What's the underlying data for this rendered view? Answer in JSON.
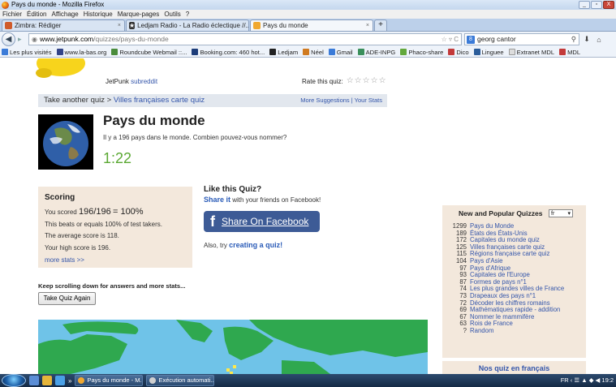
{
  "window": {
    "title": "Pays du monde - Mozilla Firefox",
    "controls": [
      "_",
      "▫",
      "X"
    ]
  },
  "menu": [
    "Fichier",
    "Édition",
    "Affichage",
    "Historique",
    "Marque-pages",
    "Outils",
    "?"
  ],
  "tabs": [
    {
      "label": "Zimbra: Rédiger",
      "icon_color": "#d05b2a"
    },
    {
      "label": "Ledjam Radio - La Radio éclectique //...",
      "icon_color": "#333333"
    },
    {
      "label": "Pays du monde",
      "icon_color": "#f0a830",
      "active": true
    }
  ],
  "newtab": "+",
  "urlbar": {
    "host": "www.jetpunk.com",
    "path": "/quizzes/pays-du-monde",
    "icons": "☆ ▿ C"
  },
  "search": {
    "value": "georg cantor",
    "engine_letter": "8"
  },
  "bookmarks": [
    {
      "label": "Les plus visités",
      "color": "#3b7bd8"
    },
    {
      "label": "www.la-bas.org",
      "color": "#334488"
    },
    {
      "label": "Roundcube Webmail ::...",
      "color": "#4a8c3c"
    },
    {
      "label": "Booking.com: 460 hot...",
      "color": "#1d3d7a"
    },
    {
      "label": "Ledjam",
      "color": "#222222"
    },
    {
      "label": "Néel",
      "color": "#d07a20"
    },
    {
      "label": "Gmail",
      "color": "#3b7bd8"
    },
    {
      "label": "ADE-INPG",
      "color": "#3a8f5b"
    },
    {
      "label": "Phaco-share",
      "color": "#63a83c"
    },
    {
      "label": "Dico",
      "color": "#c33a3a"
    },
    {
      "label": "Linguee",
      "color": "#2a5c9a"
    },
    {
      "label": "Extranet MDL",
      "color": "#cccccc"
    },
    {
      "label": "MDL",
      "color": "#c33a3a"
    }
  ],
  "page": {
    "subreddit_prefix": "JetPunk",
    "subreddit_link": "subreddit",
    "rate_label": "Rate this quiz:",
    "rate_stars": "☆☆☆☆☆",
    "crumb_prefix": "Take another quiz >",
    "crumb_link": "Villes françaises carte quiz",
    "crumb_more": "More Suggestions | Your Stats",
    "title": "Pays du monde",
    "description": "Il y a 196 pays dans le monde. Combien pouvez-vous nommer?",
    "timer": "1:22"
  },
  "scoring": {
    "heading": "Scoring",
    "scored_prefix": "You scored",
    "scored_value": "196/196",
    "scored_suffix": "= 100%",
    "beats": "This beats or equals 100% of test takers.",
    "average": "The average score is 118.",
    "high": "Your high score is 196.",
    "more": "more stats >>"
  },
  "like": {
    "heading": "Like this Quiz?",
    "share_link": "Share it",
    "share_rest": "with your friends on Facebook!",
    "fb_f": "f",
    "fb_label": "Share On Facebook",
    "also_prefix": "Also, try",
    "also_link": "creating a quiz!"
  },
  "keep_text": "Keep scrolling down for answers and more stats...",
  "again_button": "Take Quiz Again",
  "newpop": {
    "heading": "New and Popular Quizzes",
    "lang": "fr",
    "items": [
      {
        "n": "1299",
        "label": "Pays du Monde"
      },
      {
        "n": "189",
        "label": "États des États-Unis"
      },
      {
        "n": "172",
        "label": "Capitales du monde quiz"
      },
      {
        "n": "125",
        "label": "Villes françaises carte quiz"
      },
      {
        "n": "115",
        "label": "Régions française carte quiz"
      },
      {
        "n": "104",
        "label": "Pays d'Asie"
      },
      {
        "n": "97",
        "label": "Pays d'Afrique"
      },
      {
        "n": "93",
        "label": "Capitales de l'Europe"
      },
      {
        "n": "87",
        "label": "Formes de pays n°1"
      },
      {
        "n": "74",
        "label": "Les plus grandes villes de France"
      },
      {
        "n": "73",
        "label": "Drapeaux des pays n°1"
      },
      {
        "n": "72",
        "label": "Décoder les chiffres romains"
      },
      {
        "n": "69",
        "label": "Mathématiques rapide - addition"
      },
      {
        "n": "67",
        "label": "Nommer le mammifère"
      },
      {
        "n": "63",
        "label": "Rois de France"
      },
      {
        "n": "?",
        "label": "Random"
      }
    ]
  },
  "nosquiz": "Nos quiz en français",
  "taskbar": {
    "quick": [
      "»"
    ],
    "tasks": [
      {
        "label": "Pays du monde - M...",
        "color": "#f0a830"
      },
      {
        "label": "Exécution automati...",
        "color": "#d0d0d0"
      }
    ],
    "tray": "FR  ‹  ☰  ▲  ◆  ◀  19:2"
  },
  "colors": {
    "accent_link": "#3355aa",
    "timer_green": "#5aa832",
    "facebook_blue": "#3d5b96",
    "panel_beige": "#f3e8dc"
  }
}
